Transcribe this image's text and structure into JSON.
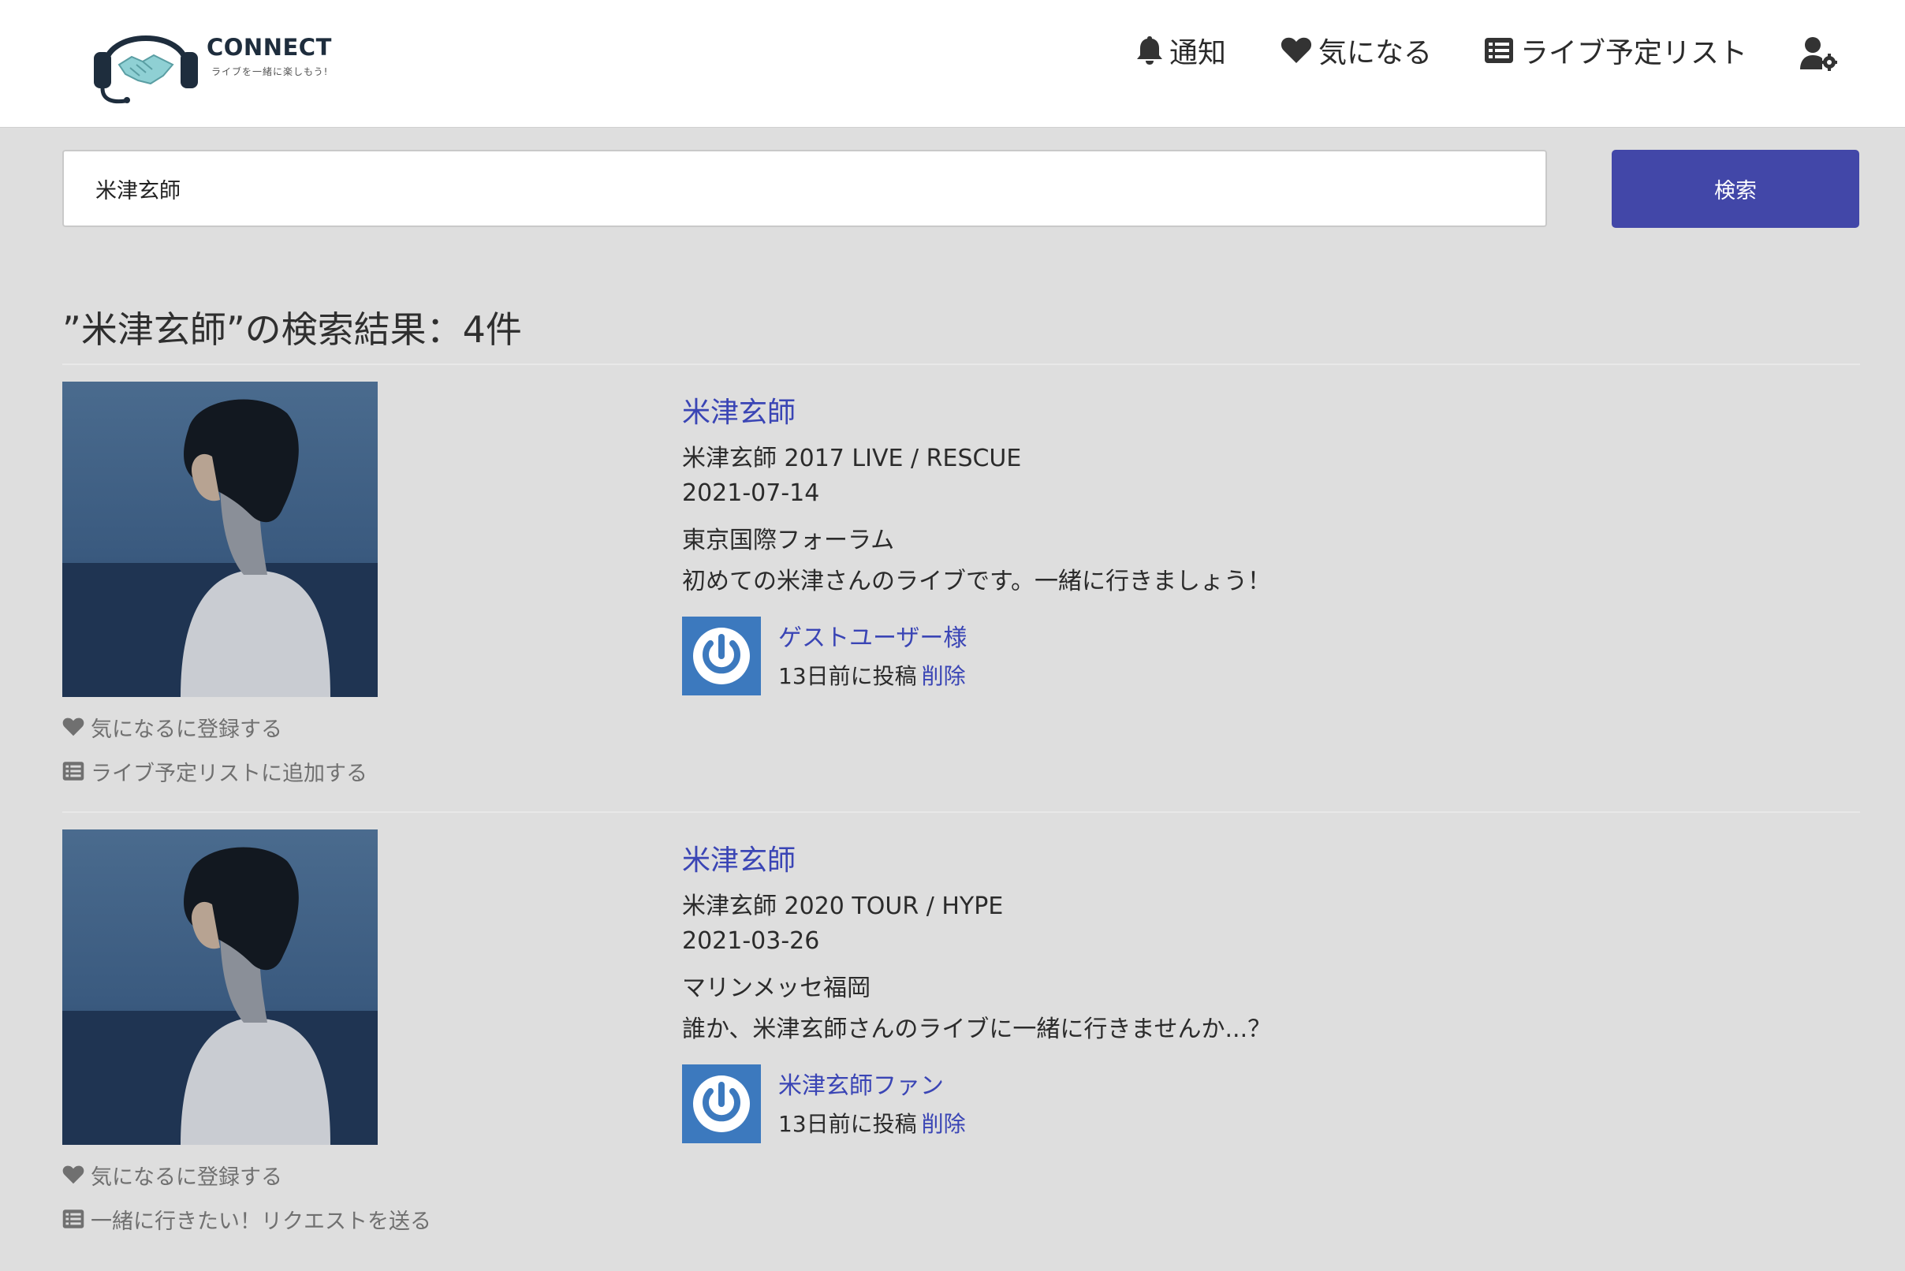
{
  "header": {
    "logo_title": "CONNECT",
    "logo_subtitle": "ライブを一緒に楽しもう!",
    "nav": {
      "notify": "通知",
      "favorite": "気になる",
      "live_list": "ライブ予定リスト"
    }
  },
  "search": {
    "value": "米津玄師",
    "button": "検索"
  },
  "results": {
    "heading": "”米津玄師”の検索結果：4件",
    "items": [
      {
        "artist": "米津玄師",
        "title": "米津玄師 2017 LIVE / RESCUE",
        "date": "2021-07-14",
        "venue": "東京国際フォーラム",
        "message": "初めての米津さんのライブです。一緒に行きましょう！",
        "user": "ゲストユーザー様",
        "posted": "13日前に投稿",
        "delete": "削除",
        "action1": "気になるに登録する",
        "action2": "ライブ予定リストに追加する"
      },
      {
        "artist": "米津玄師",
        "title": "米津玄師 2020 TOUR / HYPE",
        "date": "2021-03-26",
        "venue": "マリンメッセ福岡",
        "message": "誰か、米津玄師さんのライブに一緒に行きませんか...？",
        "user": "米津玄師ファン",
        "posted": "13日前に投稿",
        "delete": "削除",
        "action1": "気になるに登録する",
        "action2": "一緒に行きたい！リクエストを送る"
      }
    ]
  },
  "colors": {
    "accent": "#4247a8",
    "link": "#3a45b5",
    "avatar": "#3c79be",
    "background": "#dedede"
  }
}
